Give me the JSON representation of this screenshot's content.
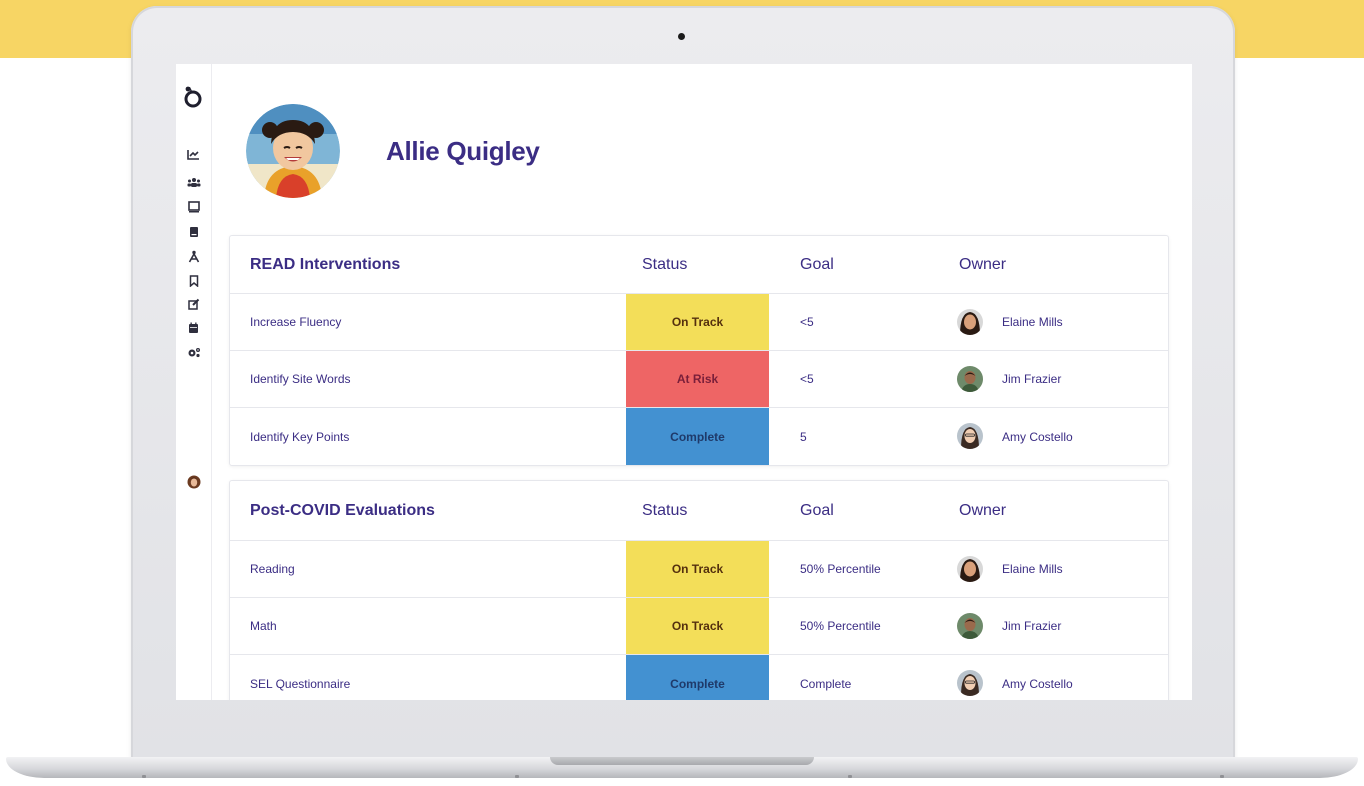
{
  "student": {
    "name": "Allie Quigley"
  },
  "sidebar": {
    "icons": [
      "app-logo-icon",
      "chart-icon",
      "users-icon",
      "monitor-icon",
      "book-icon",
      "compass-icon",
      "bookmark-icon",
      "edit-icon",
      "calendar-icon",
      "settings-icon",
      "user-avatar"
    ]
  },
  "tables": [
    {
      "title": "READ Interventions",
      "columns": {
        "status": "Status",
        "goal": "Goal",
        "owner": "Owner"
      },
      "rows": [
        {
          "name": "Increase Fluency",
          "status": "On Track",
          "goal": "<5",
          "owner": "Elaine Mills"
        },
        {
          "name": "Identify Site Words",
          "status": "At Risk",
          "goal": "<5",
          "owner": "Jim Frazier"
        },
        {
          "name": "Identify Key Points",
          "status": "Complete",
          "goal": "5",
          "owner": "Amy Costello"
        }
      ]
    },
    {
      "title": "Post-COVID Evaluations",
      "columns": {
        "status": "Status",
        "goal": "Goal",
        "owner": "Owner"
      },
      "rows": [
        {
          "name": "Reading",
          "status": "On Track",
          "goal": "50% Percentile",
          "owner": "Elaine Mills"
        },
        {
          "name": "Math",
          "status": "On Track",
          "goal": "50% Percentile",
          "owner": "Jim Frazier"
        },
        {
          "name": "SEL Questionnaire",
          "status": "Complete",
          "goal": "Complete",
          "owner": "Amy Costello"
        }
      ]
    }
  ],
  "colors": {
    "on_track": "#f3de59",
    "at_risk": "#ee6565",
    "complete": "#4391d1",
    "brand_text": "#3b2d84",
    "background_band": "#f7d564"
  }
}
